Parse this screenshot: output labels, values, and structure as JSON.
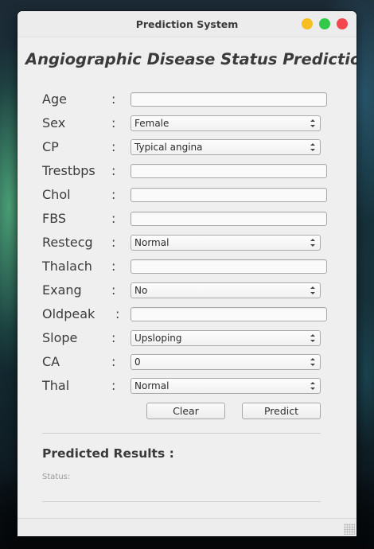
{
  "window": {
    "title": "Prediction System"
  },
  "heading": "Angiographic Disease Status Prediction",
  "colon": ":",
  "fields": [
    {
      "label": "Age",
      "type": "input",
      "value": ""
    },
    {
      "label": "Sex",
      "type": "select",
      "value": "Female"
    },
    {
      "label": "CP",
      "type": "select",
      "value": "Typical angina"
    },
    {
      "label": "Trestbps",
      "type": "input",
      "value": ""
    },
    {
      "label": "Chol",
      "type": "input",
      "value": ""
    },
    {
      "label": "FBS",
      "type": "input",
      "value": ""
    },
    {
      "label": "Restecg",
      "type": "select",
      "value": "Normal"
    },
    {
      "label": "Thalach",
      "type": "input",
      "value": ""
    },
    {
      "label": "Exang",
      "type": "select",
      "value": "No"
    },
    {
      "label": "Oldpeak",
      "type": "input",
      "value": ""
    },
    {
      "label": "Slope",
      "type": "select",
      "value": "Upsloping"
    },
    {
      "label": "CA",
      "type": "select",
      "value": "0"
    },
    {
      "label": "Thal",
      "type": "select",
      "value": "Normal"
    }
  ],
  "buttons": {
    "clear": "Clear",
    "predict": "Predict"
  },
  "results": {
    "title": "Predicted Results :",
    "status_label": "Status:"
  }
}
